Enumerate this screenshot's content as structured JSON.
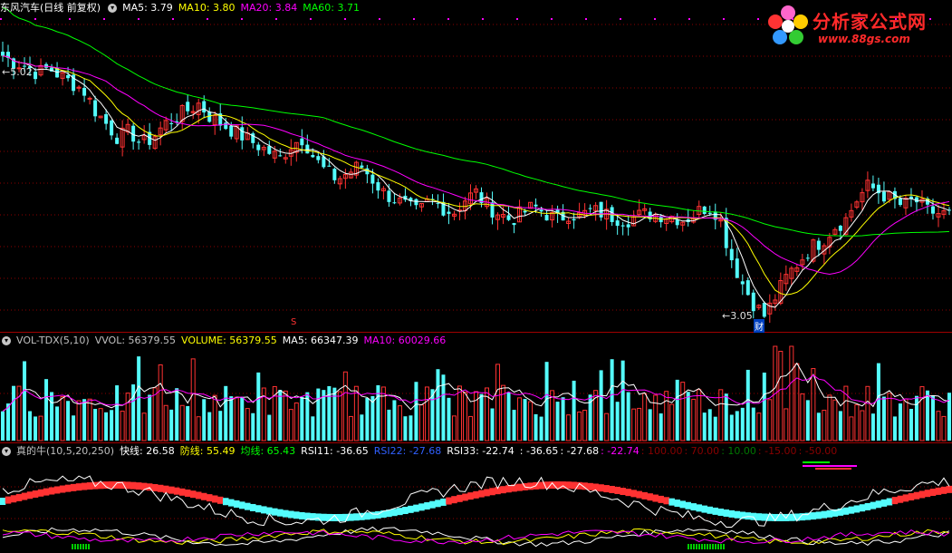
{
  "colors": {
    "bg": "#000000",
    "up": "#ff3232",
    "down": "#54fcfc",
    "ma5": "#ffffff",
    "ma10": "#ffff00",
    "ma20": "#ff00ff",
    "ma60": "#00ff00",
    "grid": "#8b0000",
    "sep": "#a00000"
  },
  "main_panel": {
    "title": "东风汽车",
    "period": "(日线 前复权)",
    "ma5": "MA5: 3.79",
    "ma10": "MA10: 3.80",
    "ma20": "MA20: 3.84",
    "ma60": "MA60: 3.71",
    "high_label": "5.02",
    "low_label": "3.05",
    "marker_s": "S",
    "marker_cai": "财"
  },
  "volume_panel": {
    "name": "VOL-TDX(5,10)",
    "vvol": "VVOL: 56379.55",
    "volume": "VOLUME: 56379.55",
    "ma5": "MA5: 66347.39",
    "ma10": "MA10: 60029.66"
  },
  "indicator_panel": {
    "name": "真的牛(10,5,20,250)",
    "fast": "快线: 26.58",
    "defense": "防线: 55.49",
    "avg": "均线: 65.43",
    "rsi11": "RSI11: -36.65",
    "rsi22": "RSI22: -27.68",
    "rsi33": "RSI33: -22.74",
    "v1": ": -36.65",
    "v2": ": -27.68",
    "v3": ": -22.74",
    "v4": ": 100.00",
    "v5": ": 70.00",
    "v6": ": 10.00",
    "v7": ": -15.00",
    "v8": ": -50.00"
  },
  "logo": {
    "text": "分析家公式网",
    "url": "www.88gs.com"
  },
  "chart_data": {
    "type": "candlestick",
    "price_range": [
      2.95,
      5.25
    ],
    "candle_closes_approx": [
      4.95,
      4.9,
      4.88,
      4.82,
      4.86,
      4.8,
      4.75,
      4.7,
      4.55,
      4.45,
      4.35,
      4.4,
      4.3,
      4.35,
      4.45,
      4.5,
      4.55,
      4.6,
      4.5,
      4.45,
      4.4,
      4.35,
      4.3,
      4.25,
      4.2,
      4.3,
      4.35,
      4.2,
      4.1,
      4.05,
      4.1,
      4.15,
      4.05,
      3.95,
      3.9,
      3.85,
      3.8,
      3.9,
      3.85,
      3.8,
      3.9,
      3.95,
      3.85,
      3.8,
      3.75,
      3.8,
      3.85,
      3.8,
      3.75,
      3.8,
      3.78,
      3.82,
      3.8,
      3.77,
      3.75,
      3.78,
      3.8,
      3.79,
      3.78,
      3.75,
      3.8,
      3.85,
      3.8,
      3.5,
      3.3,
      3.15,
      3.05,
      3.2,
      3.35,
      3.45,
      3.55,
      3.6,
      3.7,
      3.75,
      3.9,
      4.0,
      3.95,
      3.9,
      3.85,
      3.9,
      3.82,
      3.8,
      3.79
    ]
  }
}
